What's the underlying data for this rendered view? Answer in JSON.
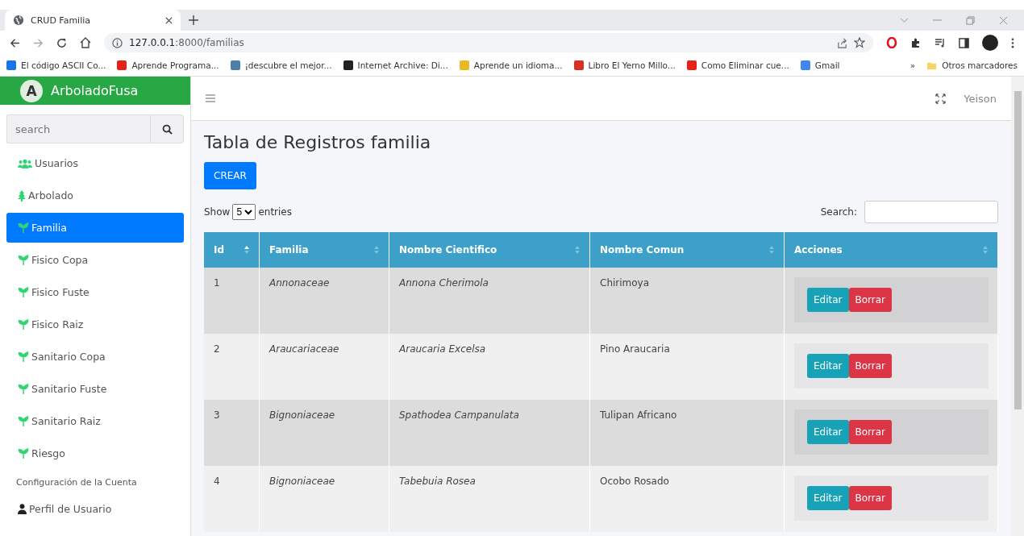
{
  "browser": {
    "tab_title": "CRUD Familia",
    "url_host": "127.0.0.1",
    "url_path": ":8000/familias",
    "bookmarks": [
      {
        "label": "El código ASCII Co...",
        "color": "#1a73e8"
      },
      {
        "label": "Aprende Programa...",
        "color": "#e62117"
      },
      {
        "label": "¡descubre el mejor...",
        "color": "#4a7fa8"
      },
      {
        "label": "Internet Archive: Di...",
        "color": "#222222"
      },
      {
        "label": "Aprende un idioma...",
        "color": "#e8b923"
      },
      {
        "label": "Libro El Yerno Millo...",
        "color": "#d93025"
      },
      {
        "label": "Como Eliminar cue...",
        "color": "#e62117"
      },
      {
        "label": "Gmail",
        "color": "#4285f4"
      }
    ],
    "more": "»",
    "other_bookmarks": "Otros marcadores"
  },
  "sidebar": {
    "brand": "ArboladoFusa",
    "brand_letter": "A",
    "search": {
      "placeholder": "search"
    },
    "items": [
      {
        "label": "Usuarios",
        "kind": "users",
        "selected": false
      },
      {
        "label": "Arbolado",
        "kind": "tree",
        "selected": false
      },
      {
        "label": "Familia",
        "kind": "seedling",
        "selected": true
      },
      {
        "label": "Fisico Copa",
        "kind": "seedling",
        "selected": false
      },
      {
        "label": "Fisico Fuste",
        "kind": "seedling",
        "selected": false
      },
      {
        "label": "Fisico Raiz",
        "kind": "seedling",
        "selected": false
      },
      {
        "label": "Sanitario Copa",
        "kind": "seedling",
        "selected": false
      },
      {
        "label": "Sanitario Fuste",
        "kind": "seedling",
        "selected": false
      },
      {
        "label": "Sanitario Raiz",
        "kind": "seedling",
        "selected": false
      },
      {
        "label": "Riesgo",
        "kind": "seedling",
        "selected": false
      }
    ],
    "section_header": "Configuración de la Cuenta",
    "section_items": [
      {
        "label": "Perfil de Usuario",
        "kind": "user"
      }
    ]
  },
  "navbar": {
    "user": "Yeison"
  },
  "page": {
    "title": "Tabla de Registros familia",
    "create_button": "CREAR",
    "length": {
      "show": "Show",
      "value": "5",
      "entries": "entries"
    },
    "search_label": "Search:",
    "table": {
      "columns": [
        {
          "label": "Id",
          "sorted": true
        },
        {
          "label": "Familia",
          "sorted": false
        },
        {
          "label": "Nombre Cientifico",
          "sorted": false
        },
        {
          "label": "Nombre Comun",
          "sorted": false
        },
        {
          "label": "Acciones",
          "sorted": false
        }
      ],
      "rows": [
        {
          "id": "1",
          "familia": "Annonaceae",
          "cientifico": "Annona Cherimola",
          "comun": "Chirimoya",
          "edit": "Editar",
          "delete": "Borrar"
        },
        {
          "id": "2",
          "familia": "Araucariaceae",
          "cientifico": "Araucaria Excelsa",
          "comun": "Pino Araucaria",
          "edit": "Editar",
          "delete": "Borrar"
        },
        {
          "id": "3",
          "familia": "Bignoniaceae",
          "cientifico": "Spathodea Campanulata",
          "comun": "Tulipan Africano",
          "edit": "Editar",
          "delete": "Borrar"
        },
        {
          "id": "4",
          "familia": "Bignoniaceae",
          "cientifico": "Tabebuia Rosea",
          "comun": "Ocobo Rosado",
          "edit": "Editar",
          "delete": "Borrar"
        }
      ]
    }
  }
}
